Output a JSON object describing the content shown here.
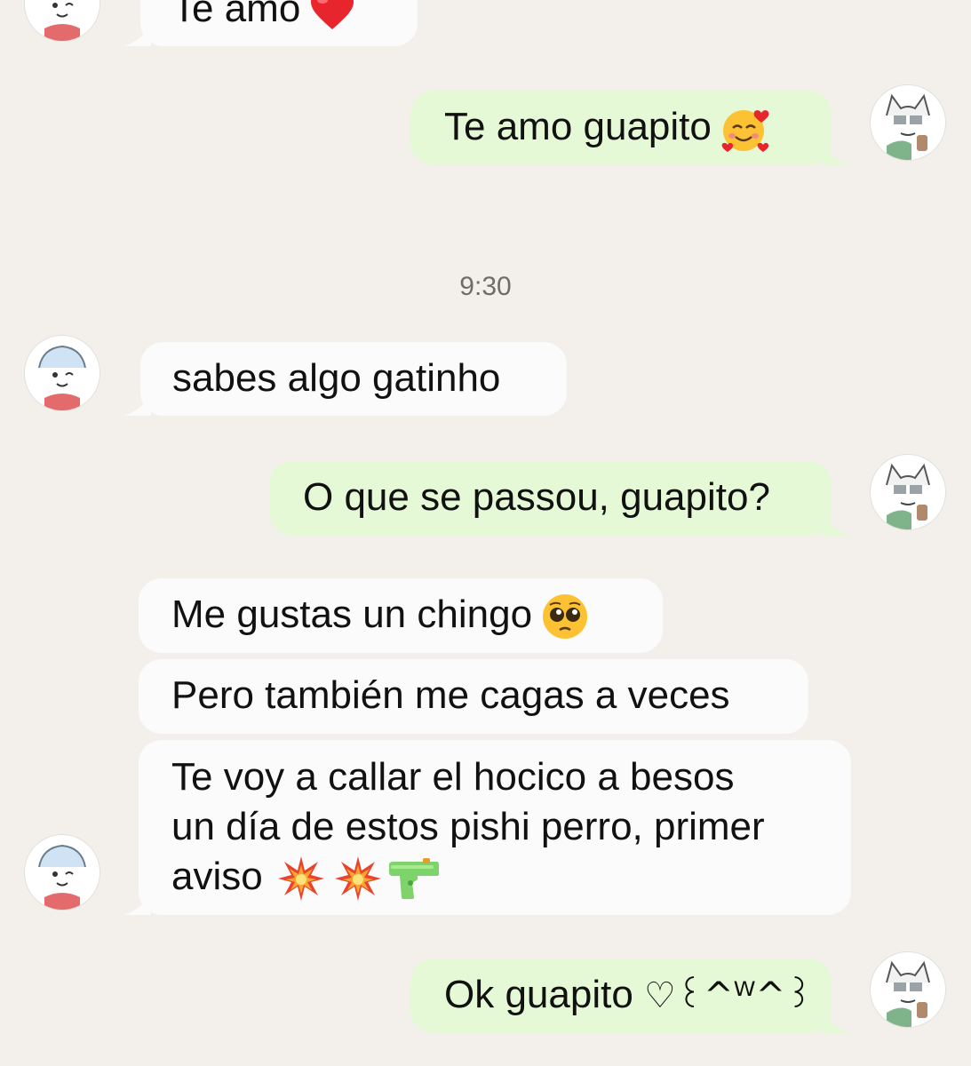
{
  "messages": [
    {
      "text": "Te amo"
    },
    {
      "text": "Te amo guapito"
    },
    {
      "text": "sabes algo gatinho"
    },
    {
      "text": "O que se passou, guapito?"
    },
    {
      "text": "Me gustas un chingo"
    },
    {
      "text": "Pero también me cagas a veces"
    },
    {
      "lines": [
        "Te voy a callar el hocico a besos",
        "un día de estos pishi perro, primer",
        "aviso"
      ]
    },
    {
      "text": "Ok guapito",
      "kaomoji": "♡꒰^ᵂ^꒱"
    }
  ],
  "timestamp": "9:30",
  "icons": {
    "heart": "red-heart-icon",
    "smiling_hearts": "smiling-face-with-hearts-icon",
    "pleading": "pleading-face-icon",
    "collision": "collision-icon",
    "water_pistol": "water-pistol-icon"
  },
  "colors": {
    "background": "#f3f0ec",
    "incoming_bubble": "#fbfbfb",
    "outgoing_bubble": "#e6f9d7"
  }
}
